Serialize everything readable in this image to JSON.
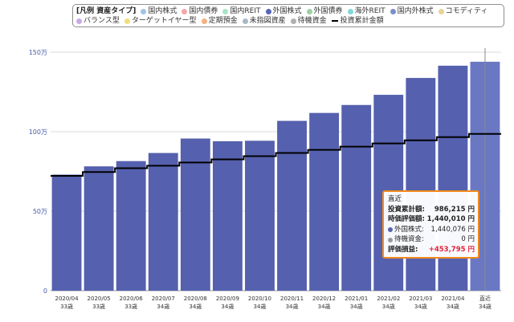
{
  "legend": {
    "title": "[凡例 資産タイプ]",
    "items": [
      {
        "label": "国内株式",
        "color": "#9fc5e8",
        "icon": "dot"
      },
      {
        "label": "国内債券",
        "color": "#f4a7a7",
        "icon": "dot"
      },
      {
        "label": "国内REIT",
        "color": "#a8e6c7",
        "icon": "dot"
      },
      {
        "label": "外国株式",
        "color": "#5566b3",
        "icon": "dot"
      },
      {
        "label": "外国債券",
        "color": "#9ed0a0",
        "icon": "dot"
      },
      {
        "label": "海外REIT",
        "color": "#7fd9d9",
        "icon": "dot"
      },
      {
        "label": "国内外株式",
        "color": "#7a8fcc",
        "icon": "dot"
      },
      {
        "label": "コモディティ",
        "color": "#e8d39a",
        "icon": "dot"
      },
      {
        "label": "バランス型",
        "color": "#c9a8e6",
        "icon": "dot"
      },
      {
        "label": "ターゲットイヤー型",
        "color": "#f2df7a",
        "icon": "dot"
      },
      {
        "label": "定期預金",
        "color": "#f4b183",
        "icon": "dot"
      },
      {
        "label": "未指図資産",
        "color": "#a9b8c4",
        "icon": "dot"
      },
      {
        "label": "待機資金",
        "color": "#b0b0b0",
        "icon": "dot"
      },
      {
        "label": "投資累計金額",
        "color": "#000000",
        "icon": "line"
      }
    ]
  },
  "chart_data": {
    "type": "bar",
    "categories": [
      {
        "date": "2020/04",
        "age": "33歳"
      },
      {
        "date": "2020/05",
        "age": "33歳"
      },
      {
        "date": "2020/06",
        "age": "33歳"
      },
      {
        "date": "2020/07",
        "age": "34歳"
      },
      {
        "date": "2020/08",
        "age": "34歳"
      },
      {
        "date": "2020/09",
        "age": "34歳"
      },
      {
        "date": "2020/10",
        "age": "34歳"
      },
      {
        "date": "2020/11",
        "age": "34歳"
      },
      {
        "date": "2020/12",
        "age": "34歳"
      },
      {
        "date": "2021/01",
        "age": "34歳"
      },
      {
        "date": "2021/02",
        "age": "34歳"
      },
      {
        "date": "2021/03",
        "age": "34歳"
      },
      {
        "date": "2021/04",
        "age": "34歳"
      },
      {
        "date": "直近",
        "age": "34歳"
      }
    ],
    "series": [
      {
        "name": "外国株式",
        "type": "bar",
        "color": "#5560ae",
        "highlight_color": "#6a78c4",
        "values": [
          730000,
          782000,
          815000,
          866000,
          957000,
          940000,
          943000,
          1068000,
          1118000,
          1168000,
          1232000,
          1338000,
          1415000,
          1440010
        ]
      },
      {
        "name": "投資累計金額",
        "type": "step-line",
        "color": "#000000",
        "values": [
          722000,
          746000,
          770000,
          786000,
          806000,
          826000,
          846000,
          866000,
          886000,
          906000,
          926000,
          946000,
          966000,
          986215
        ]
      }
    ],
    "yaxis": {
      "min": 0,
      "max": 1500000,
      "ticks": [
        {
          "value": 0,
          "label": "0"
        },
        {
          "value": 500000,
          "label": "50万"
        },
        {
          "value": 1000000,
          "label": "100万"
        },
        {
          "value": 1500000,
          "label": "150万"
        }
      ]
    },
    "grid": true,
    "legend_position": "top"
  },
  "tooltip": {
    "title": "直近",
    "rows": [
      {
        "label": "投資累計額:",
        "value": "986,215 円",
        "style": "bold"
      },
      {
        "label": "時価評価額:",
        "value": "1,440,010 円",
        "style": "bold"
      },
      {
        "label": "外国株式:",
        "value": "1,440,076 円",
        "style": "normal",
        "dot_color": "#5566b3"
      },
      {
        "label": "待機資金:",
        "value": "0 円",
        "style": "normal",
        "dot_color": "#9a9a9a"
      },
      {
        "label": "評価損益:",
        "value": "+453,795 円",
        "style": "red"
      }
    ]
  }
}
